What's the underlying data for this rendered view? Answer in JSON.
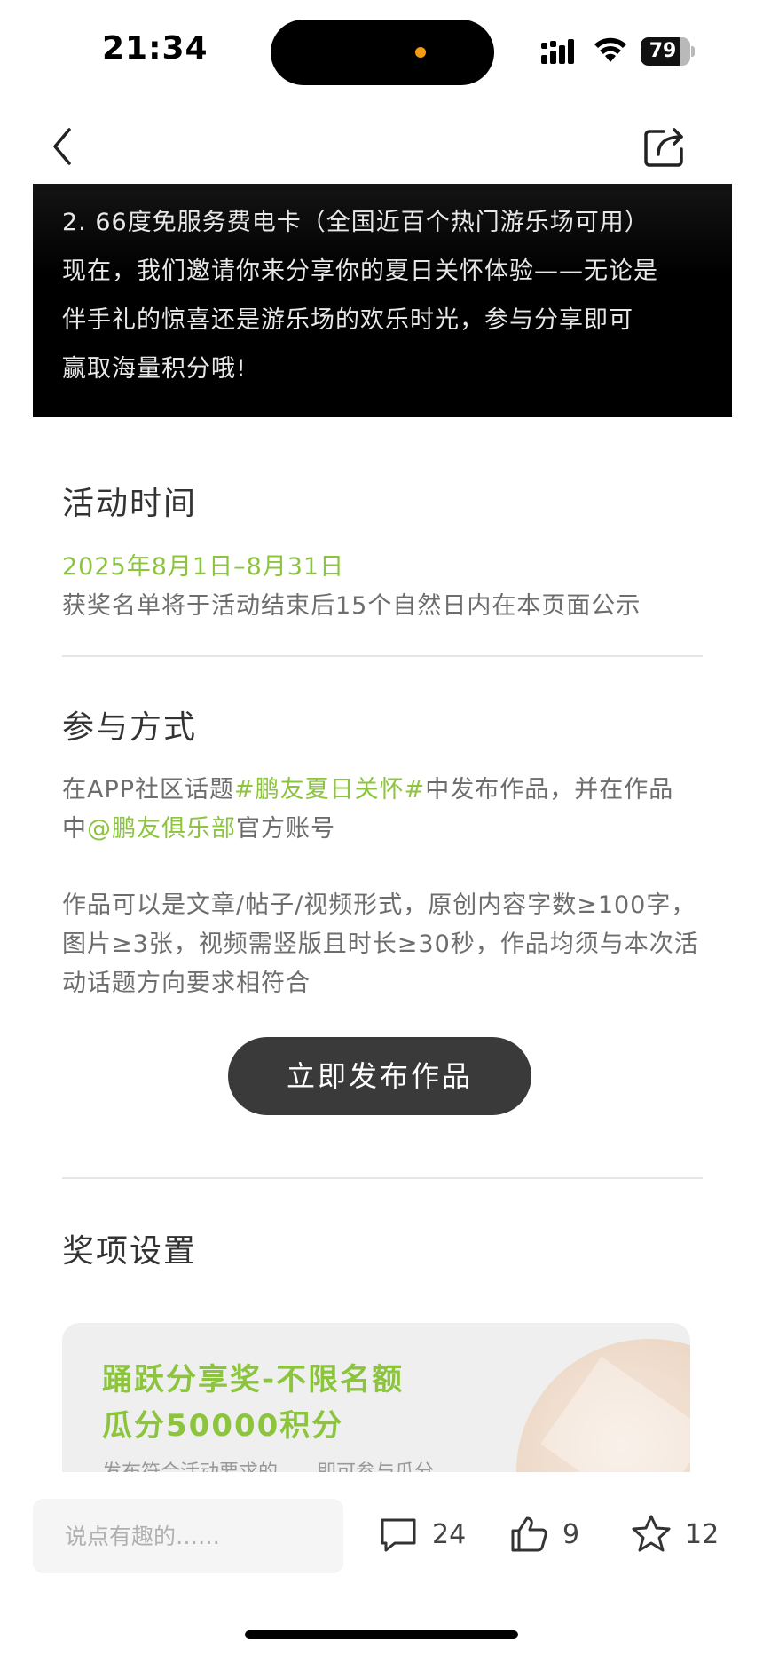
{
  "status_bar": {
    "time": "21:34",
    "battery": "79",
    "battery_level": 0.79,
    "icons": [
      "signal-icon",
      "wifi-icon",
      "battery-icon"
    ]
  },
  "nav": {
    "back_icon": "back-chevron-icon",
    "share_icon": "share-icon"
  },
  "banner": {
    "lines": [
      "2. 66度免服务费电卡（全国近百个热门游乐场可用）",
      "现在，我们邀请你来分享你的夏日关怀体验——无论是",
      "伴手礼的惊喜还是游乐场的欢乐时光，参与分享即可",
      "赢取海量积分哦!"
    ]
  },
  "event_time": {
    "title": "活动时间",
    "date": "2025年8月1日–8月31日",
    "note": "获奖名单将于活动结束后15个自然日内在本页面公示"
  },
  "participate": {
    "title": "参与方式",
    "line1_pre": "在APP社区话题",
    "topic": "#鹏友夏日关怀#",
    "line1_post": "中发布作品，并在作品",
    "line2_pre": "中",
    "mention": "@鹏友俱乐部",
    "line2_post": "官方账号",
    "works_text": "作品可以是文章/帖子/视频形式，原创内容字数≥100字，图片≥3张，视频需竖版且时长≥30秒，作品均须与本次活动话题方向要求相符合",
    "button": "立即发布作品"
  },
  "prizes": {
    "title": "奖项设置",
    "card_line1": "踊跃分享奖-不限名额",
    "card_line2": "瓜分50000积分",
    "card_partial": "发布符合活动要求的……即可参与瓜分"
  },
  "bottom_bar": {
    "comment_placeholder": "说点有趣的……",
    "comments": "24",
    "likes": "9",
    "favorites": "12"
  },
  "colors": {
    "accent_green": "#8cc43e",
    "button_dark": "#3a3a3a",
    "banner_bg": "#000000"
  }
}
